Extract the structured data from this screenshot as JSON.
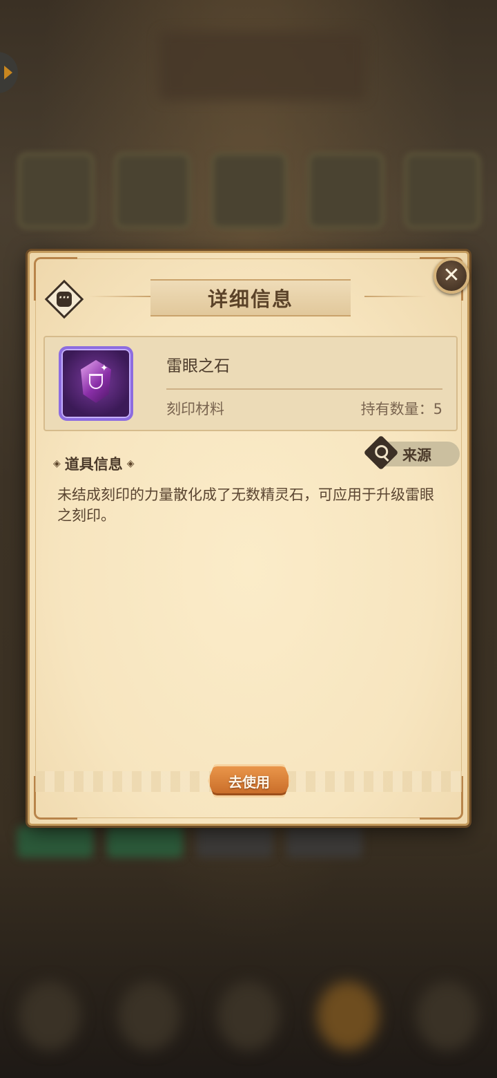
{
  "dialog": {
    "title": "详细信息",
    "item": {
      "name": "雷眼之石",
      "type": "刻印材料",
      "count_label": "持有数量：",
      "count_value": "5",
      "icon": "purple-gem-icon"
    },
    "source_label": "来源",
    "section_title": "道具信息",
    "description": "未结成刻印的力量散化成了无数精灵石，可应用于升级雷眼之刻印。",
    "use_button_label": "去使用"
  },
  "colors": {
    "panel_bg": "#f7e5bf",
    "text_dark": "#4b3a2a",
    "button_orange": "#d9782f",
    "gem_purple": "#7b3a9e"
  }
}
